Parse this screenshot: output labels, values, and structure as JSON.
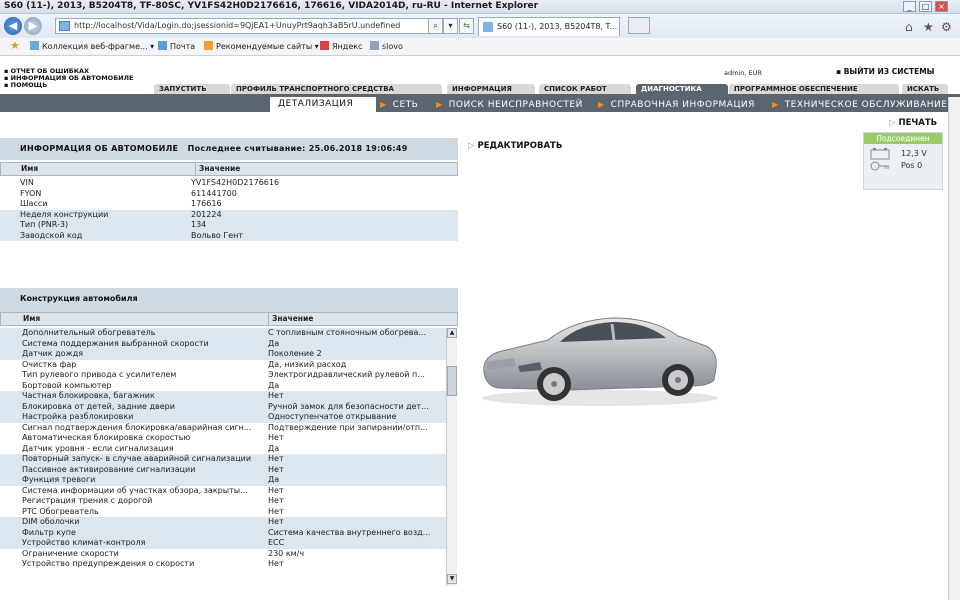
{
  "browser": {
    "title": "S60 (11-), 2013, B5204T8, TF-80SC, YV1FS42H0D2176616, 176616, VIDA2014D, ru-RU - Internet Explorer",
    "address": "http://localhost/Vida/Login.do;jsessionid=9QjEA1+UnuyPrt9aqh3aB5rU.undefined",
    "tab_title": "S60 (11-), 2013, B5204T8, T...",
    "favorites": [
      "Коллекция веб-фрагме...",
      "Почта",
      "Рекомендуемые сайты",
      "Яндекс",
      "slovo"
    ]
  },
  "app": {
    "top_links": [
      "ОТЧЕТ ОБ ОШИБКАХ",
      "ИНФОРМАЦИЯ ОБ АВТОМОБИЛЕ",
      "ПОМОЩЬ"
    ],
    "user": "admin, EUR",
    "logout": "ВЫЙТИ ИЗ СИСТЕМЫ",
    "tabs": [
      "ЗАПУСТИТЬ",
      "ПРОФИЛЬ ТРАНСПОРТНОГО СРЕДСТВА",
      "ИНФОРМАЦИЯ",
      "СПИСОК РАБОТ",
      "ДИАГНОСТИКА",
      "ПРОГРАММНОЕ ОБЕСПЕЧЕНИЕ",
      "ИСКАТЬ"
    ],
    "subtabs": [
      "ДЕТАЛИЗАЦИЯ",
      "СЕТЬ",
      "ПОИСК НЕИСПРАВНОСТЕЙ",
      "СПРАВОЧНАЯ ИНФОРМАЦИЯ",
      "ТЕХНИЧЕСКОЕ ОБСЛУЖИВАНИЕ"
    ]
  },
  "vehicle_info": {
    "title": "ИНФОРМАЦИЯ ОБ АВТОМОБИЛЕ",
    "last_read": "Последнее считывание: 25.06.2018 19:06:49",
    "col_name": "Имя",
    "col_value": "Значение",
    "rows": [
      [
        "VIN",
        "YV1FS42H0D2176616"
      ],
      [
        "FYON",
        "611441700"
      ],
      [
        "Шасси",
        "176616"
      ],
      [
        "Неделя конструкции",
        "201224"
      ],
      [
        "Тип (PNR-3)",
        "134"
      ],
      [
        "Заводской код",
        "Вольво Гент"
      ]
    ]
  },
  "construction": {
    "title": "Конструкция автомобиля",
    "col_name": "Имя",
    "col_value": "Значение",
    "rows": [
      [
        "Дополнительный обогреватель",
        "С топливным стояночным обогрева..."
      ],
      [
        "Система поддержания выбранной скорости",
        "Да"
      ],
      [
        "Датчик дождя",
        "Поколение 2"
      ],
      [
        "Очистка фар",
        "Да, низкий расход"
      ],
      [
        "Тип рулевого привода с усилителем",
        "Электрогидравлический рулевой п..."
      ],
      [
        "Бортовой компьютер",
        "Да"
      ],
      [
        "Частная блокировка, багажник",
        "Нет"
      ],
      [
        "Блокировка от детей, задние двери",
        "Ручной замок для безопасности дет..."
      ],
      [
        "Настройка разблокировки",
        "Одноступенчатое открывание"
      ],
      [
        "Сигнал подтверждения блокировка/аварийная сигн...",
        "Подтверждение при запирании/отп..."
      ],
      [
        "Автоматическая блокировка скоростью",
        "Нет"
      ],
      [
        "Датчик уровня - если сигнализация",
        "Да"
      ],
      [
        "Повторный запуск- в случае аварийной сигнализации",
        "Нет"
      ],
      [
        "Пассивное активирование сигнализации",
        "Нет"
      ],
      [
        "Функция тревоги",
        "Да"
      ],
      [
        "Система информации об участках обзора, закрыты...",
        "Нет"
      ],
      [
        "Регистрация трения с дорогой",
        "Нет"
      ],
      [
        "PTC Обогреватель",
        "Нет"
      ],
      [
        "DIM оболочки",
        "Нет"
      ],
      [
        "Фильтр купе",
        "Система качества внутреннего возд..."
      ],
      [
        "Устройство климат-контроля",
        "ECC"
      ],
      [
        "Ограничение скорости",
        "230 км/ч"
      ],
      [
        "Устройство предупреждения о скорости",
        "Нет"
      ]
    ]
  },
  "actions": {
    "edit": "РЕДАКТИРОВАТЬ",
    "print": "ПЕЧАТЬ"
  },
  "connection": {
    "status": "Подсоединен",
    "voltage": "12,3 V",
    "position": "Pos 0"
  }
}
